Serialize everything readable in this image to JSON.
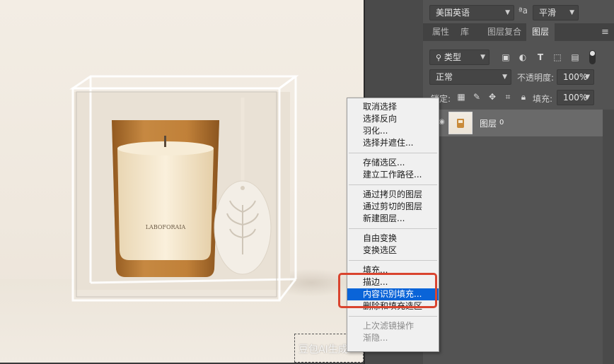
{
  "canvas": {
    "watermark": "豆包AI生成"
  },
  "context_menu": {
    "groups": [
      [
        "取消选择",
        "选择反向",
        "羽化...",
        "选择并遮住..."
      ],
      [
        "存储选区...",
        "建立工作路径..."
      ],
      [
        "通过拷贝的图层",
        "通过剪切的图层",
        "新建图层..."
      ],
      [
        "自由变换",
        "变换选区"
      ],
      [
        "填充...",
        "描边...",
        "内容识别填充...",
        "删除和填充选区"
      ],
      [
        "上次滤镜操作",
        "渐隐..."
      ]
    ],
    "selected_item": "内容识别填充...",
    "disabled_items": [
      "上次滤镜操作",
      "渐隐..."
    ]
  },
  "top_bar": {
    "language": "美国英语",
    "aa_glyph": "ªa",
    "antialias": "平滑"
  },
  "tabs": [
    "属性",
    "库",
    "图层复合",
    "图层"
  ],
  "active_tab": "图层",
  "layers_panel": {
    "filter_kind": "类型",
    "blend_mode": "正常",
    "opacity_label": "不透明度:",
    "opacity_value": "100%",
    "lock_label": "锁定:",
    "fill_label": "填充:",
    "fill_value": "100%",
    "layer_name": "图层",
    "layer_index": "0"
  },
  "colors": {
    "selection_blue": "#0a64d8",
    "annotation_red": "#d9442f",
    "panel_bg": "#535353"
  }
}
